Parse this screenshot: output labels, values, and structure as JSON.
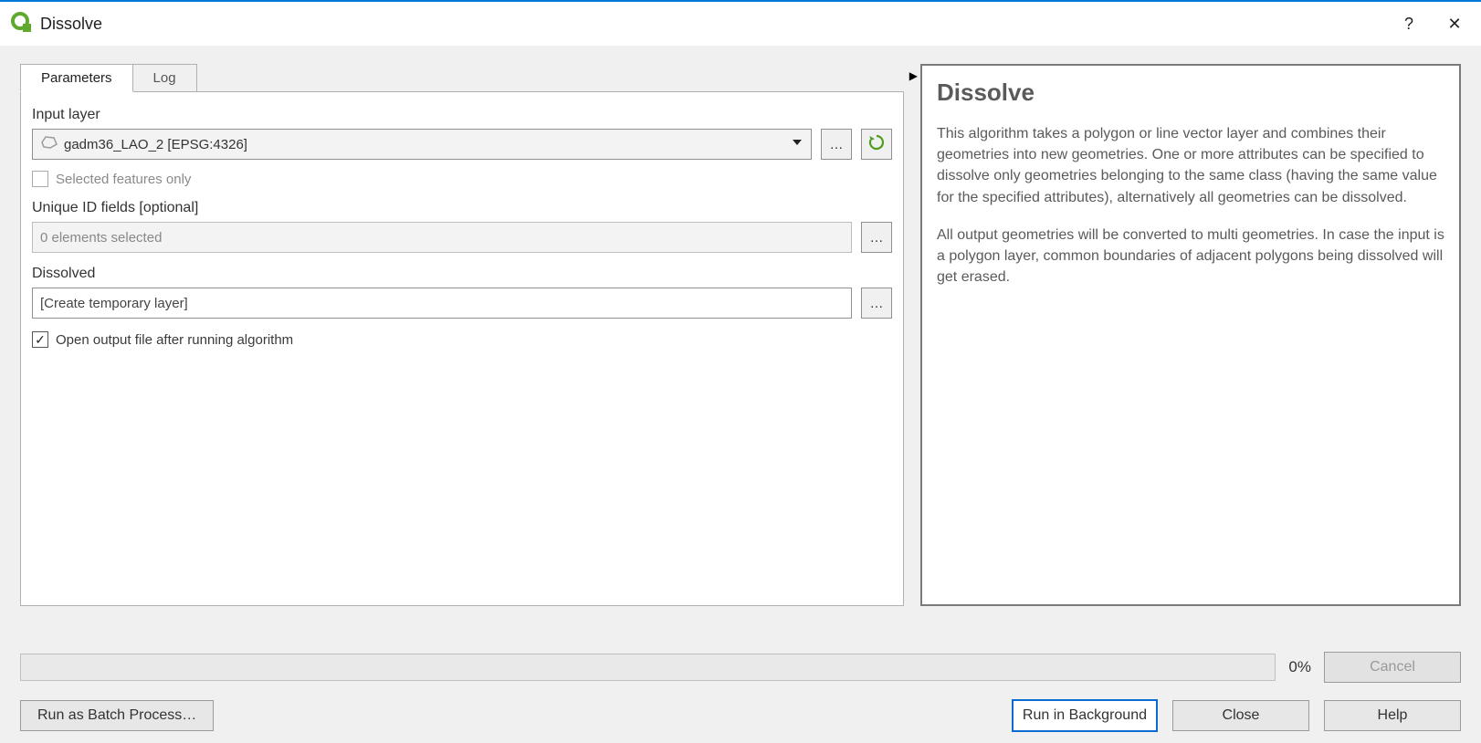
{
  "window": {
    "title": "Dissolve",
    "help_glyph": "?",
    "close_glyph": "✕"
  },
  "tabs": {
    "parameters": "Parameters",
    "log": "Log"
  },
  "params": {
    "input_layer_label": "Input layer",
    "input_layer_value": "gadm36_LAO_2 [EPSG:4326]",
    "browse_label": "…",
    "selected_only_label": "Selected features only",
    "selected_only_checked": false,
    "unique_id_label": "Unique ID fields [optional]",
    "unique_id_value": "0 elements selected",
    "dissolved_label": "Dissolved",
    "dissolved_value": "[Create temporary layer]",
    "open_output_label": "Open output file after running algorithm",
    "open_output_check_glyph": "✓"
  },
  "help": {
    "title": "Dissolve",
    "p1": "This algorithm takes a polygon or line vector layer and combines their geometries into new geometries. One or more attributes can be specified to dissolve only geometries belonging to the same class (having the same value for the specified attributes), alternatively all geometries can be dissolved.",
    "p2": "All output geometries will be converted to multi geometries. In case the input is a polygon layer, common boundaries of adjacent polygons being dissolved will get erased."
  },
  "progress": {
    "percent": "0%",
    "cancel": "Cancel"
  },
  "buttons": {
    "batch": "Run as Batch Process…",
    "run_bg": "Run in Background",
    "close": "Close",
    "help": "Help"
  },
  "arrow_glyph": "▶"
}
